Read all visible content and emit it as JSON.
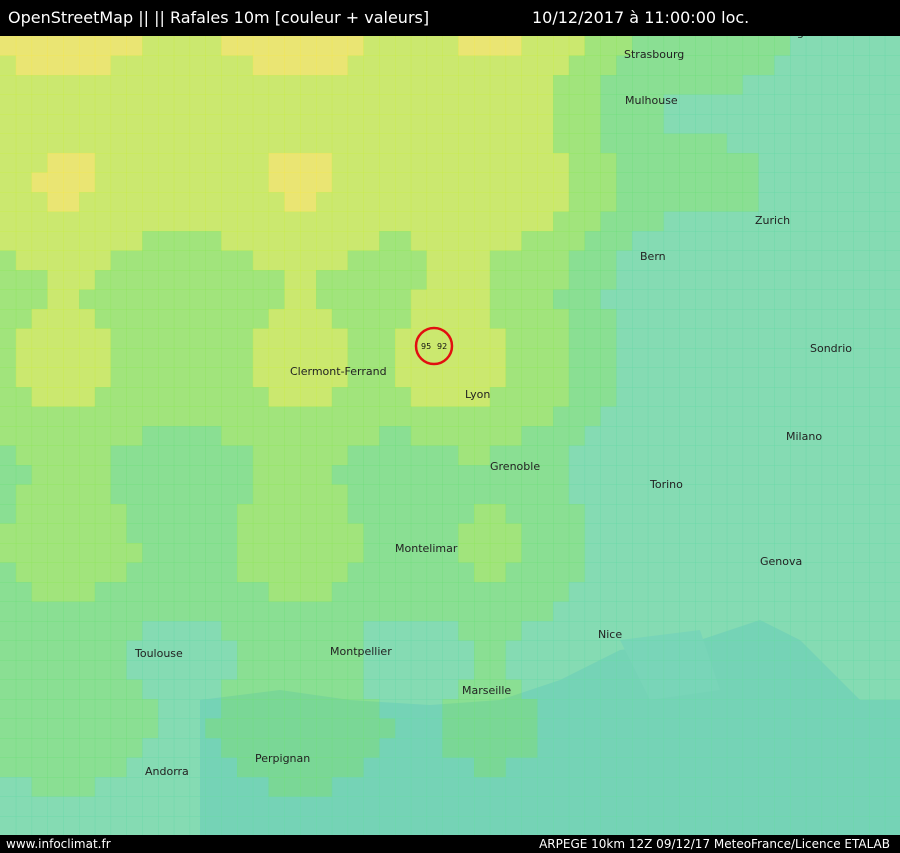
{
  "header": {
    "title_left": "OpenStreetMap ||  || Rafales 10m [couleur + valeurs]",
    "title_right": "10/12/2017 à 11:00:00 loc."
  },
  "footer": {
    "site": "www.infoclimat.fr",
    "credit": "ARPEGE 10km 12Z 09/12/17 MeteoFrance/Licence ETALAB"
  },
  "places": [
    {
      "name": "Stuttgart"
    },
    {
      "name": "Strasbourg"
    },
    {
      "name": "Zurich"
    },
    {
      "name": "Bern"
    },
    {
      "name": "Milano"
    },
    {
      "name": "Torino"
    },
    {
      "name": "Genova"
    },
    {
      "name": "Nice"
    },
    {
      "name": "Marseille"
    },
    {
      "name": "Montpellier"
    },
    {
      "name": "Toulouse"
    },
    {
      "name": "Andorra"
    },
    {
      "name": "Clermont-Ferrand"
    },
    {
      "name": "Grenoble"
    },
    {
      "name": "Lyon"
    },
    {
      "name": "Perpignan"
    },
    {
      "name": "Montelimar"
    },
    {
      "name": "Sondrio"
    },
    {
      "name": "Mulhouse"
    }
  ],
  "highlight": {
    "value_1": "95",
    "value_2": "92"
  },
  "colors": {
    "sea": "#8fb8de",
    "land": "#d7e1d3",
    "highlight_ring": "#e11010"
  }
}
